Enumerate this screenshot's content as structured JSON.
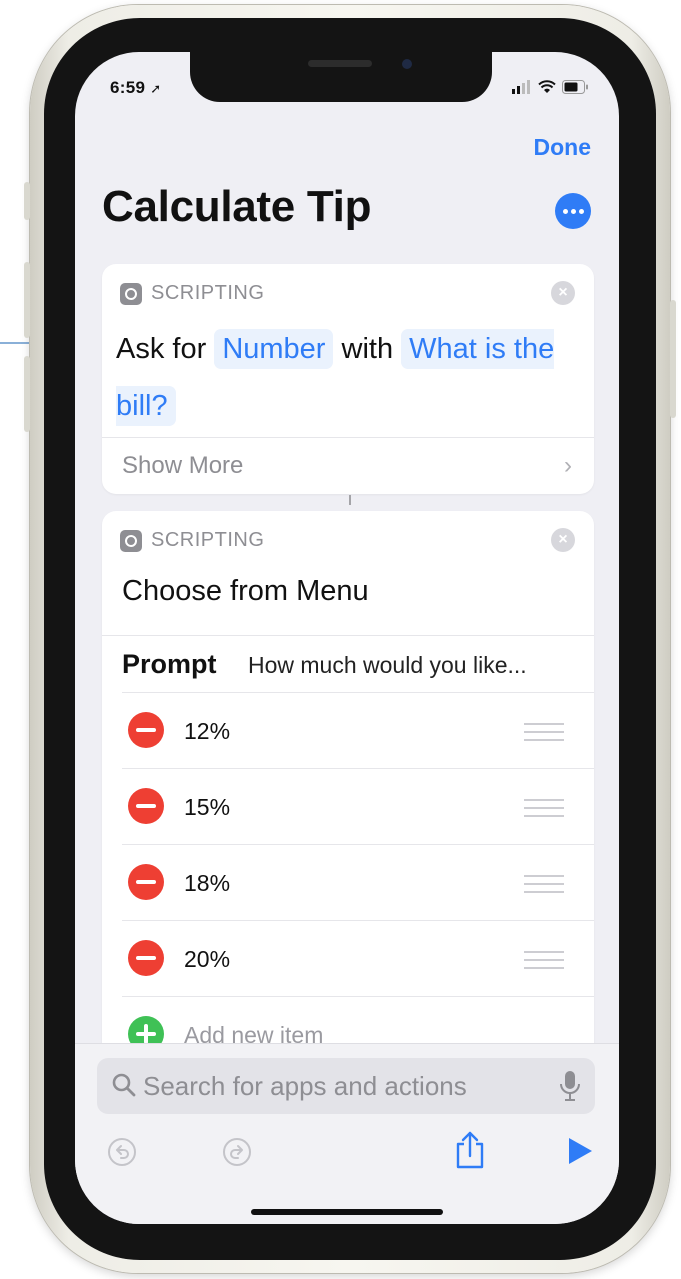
{
  "status_bar": {
    "time": "6:59"
  },
  "nav": {
    "done_label": "Done"
  },
  "header": {
    "title": "Calculate Tip"
  },
  "actions": [
    {
      "category": "SCRIPTING",
      "ask_prefix": "Ask for",
      "ask_type": "Number",
      "ask_with": "with",
      "ask_question": "What is the bill?",
      "show_more": "Show More"
    },
    {
      "category": "SCRIPTING",
      "title": "Choose from Menu",
      "prompt_label": "Prompt",
      "prompt_value": "How much would you like...",
      "items": [
        {
          "label": "12%"
        },
        {
          "label": "15%"
        },
        {
          "label": "18%"
        },
        {
          "label": "20%"
        }
      ],
      "add_item": "Add new item"
    }
  ],
  "search": {
    "placeholder": "Search for apps and actions"
  },
  "colors": {
    "accent": "#2f7cf6",
    "remove": "#ee3f33",
    "add": "#3fc156",
    "background": "#efeff4"
  },
  "icons": [
    "more-icon",
    "scripting-icon",
    "close-icon",
    "chevron-right-icon",
    "remove-icon",
    "drag-handle-icon",
    "add-icon",
    "search-icon",
    "microphone-icon",
    "undo-icon",
    "redo-icon",
    "share-icon",
    "play-icon"
  ]
}
